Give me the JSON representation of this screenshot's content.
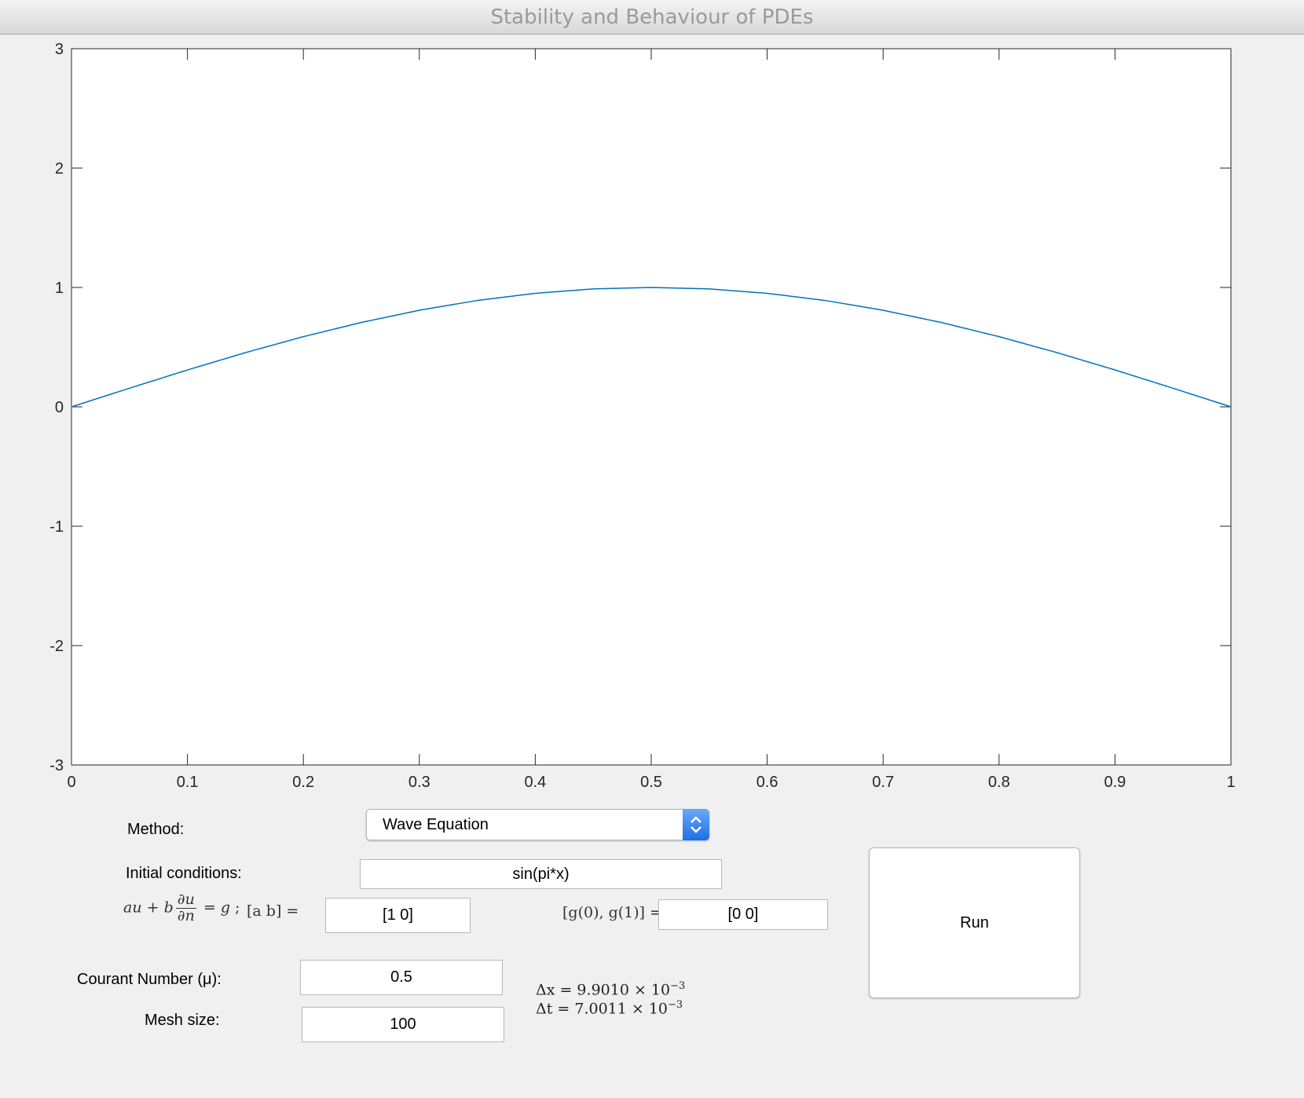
{
  "window": {
    "title": "Stability and Behaviour of PDEs"
  },
  "chart_data": {
    "type": "line",
    "x_ticks": [
      "0",
      "0.1",
      "0.2",
      "0.3",
      "0.4",
      "0.5",
      "0.6",
      "0.7",
      "0.8",
      "0.9",
      "1"
    ],
    "y_ticks": [
      "-3",
      "-2",
      "-1",
      "0",
      "1",
      "2",
      "3"
    ],
    "xlim": [
      0,
      1
    ],
    "ylim": [
      -3,
      3
    ],
    "grid": false,
    "series": [
      {
        "color": "#0072bd",
        "x": [
          0,
          0.05,
          0.1,
          0.15,
          0.2,
          0.25,
          0.3,
          0.35,
          0.4,
          0.45,
          0.5,
          0.55,
          0.6,
          0.65,
          0.7,
          0.75,
          0.8,
          0.85,
          0.9,
          0.95,
          1
        ],
        "y": [
          0,
          0.156,
          0.309,
          0.454,
          0.588,
          0.707,
          0.809,
          0.891,
          0.951,
          0.988,
          1.0,
          0.988,
          0.951,
          0.891,
          0.809,
          0.707,
          0.588,
          0.454,
          0.309,
          0.156,
          0
        ]
      }
    ]
  },
  "controls": {
    "method_label": "Method:",
    "method_value": "Wave Equation",
    "initial_label": "Initial conditions:",
    "initial_value": "sin(pi*x)",
    "boundary_ab_label": "[a b] =",
    "boundary_ab_value": "[1 0]",
    "boundary_g_label": "[g(0), g(1)] =",
    "boundary_g_value": "[0 0]",
    "courant_label": "Courant Number (μ):",
    "courant_value": "0.5",
    "mesh_label": "Mesh size:",
    "mesh_value": "100",
    "run_label": "Run"
  },
  "stats": {
    "dx_label": "Δx = 9.9010 × 10",
    "dx_exp": "−3",
    "dt_label": "Δt = 7.0011 × 10",
    "dt_exp": "−3"
  },
  "colors": {
    "line": "#0072bd",
    "select_arrow": "#1e6ee6",
    "background": "#f0f0f0"
  }
}
